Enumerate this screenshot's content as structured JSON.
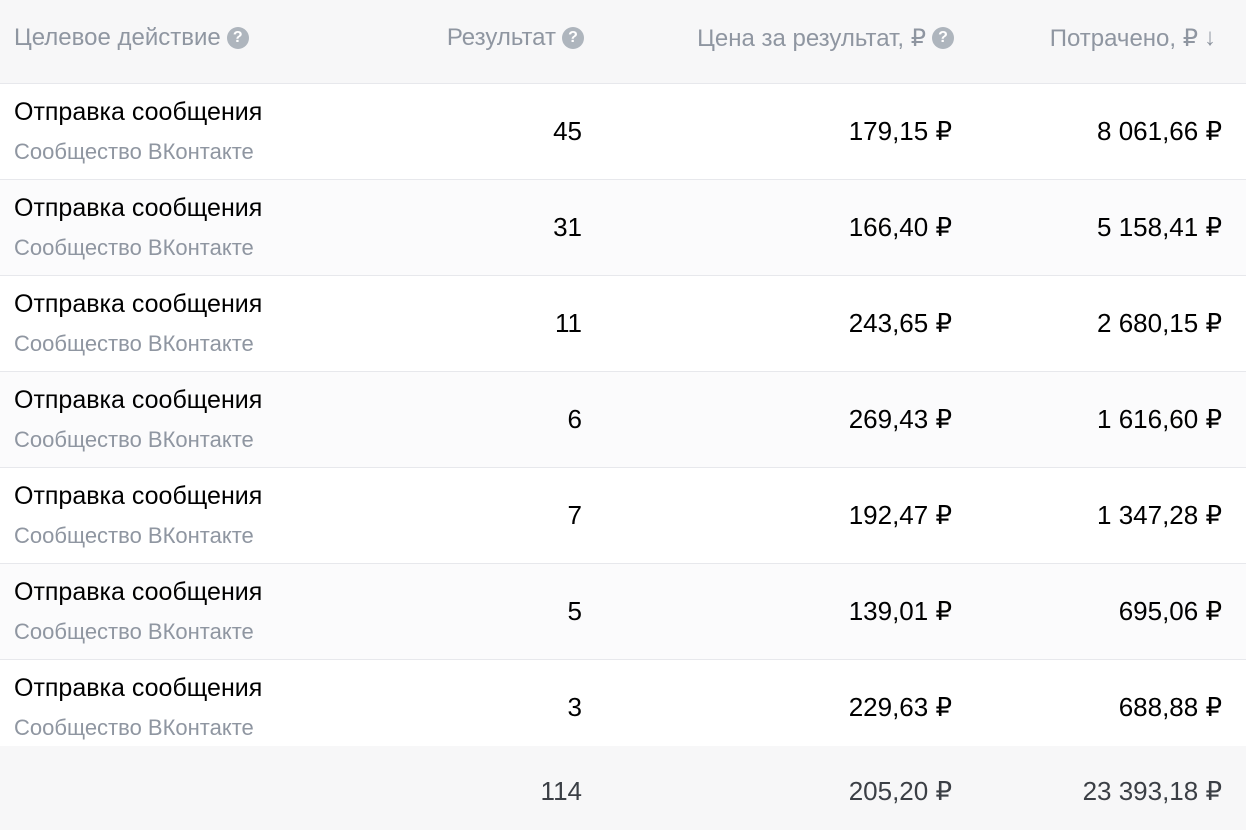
{
  "header": {
    "target_action": "Целевое действие",
    "result": "Результат",
    "price_per_result": "Цена за результат, ₽",
    "spent": "Потрачено, ₽",
    "help_glyph": "?",
    "sort_glyph": "↓"
  },
  "rows": [
    {
      "name": "Отправка сообщения",
      "source": "Сообщество ВКонтакте",
      "result": "45",
      "price": "179,15 ₽",
      "spent": "8 061,66 ₽"
    },
    {
      "name": "Отправка сообщения",
      "source": "Сообщество ВКонтакте",
      "result": "31",
      "price": "166,40 ₽",
      "spent": "5 158,41 ₽"
    },
    {
      "name": "Отправка сообщения",
      "source": "Сообщество ВКонтакте",
      "result": "11",
      "price": "243,65 ₽",
      "spent": "2 680,15 ₽"
    },
    {
      "name": "Отправка сообщения",
      "source": "Сообщество ВКонтакте",
      "result": "6",
      "price": "269,43 ₽",
      "spent": "1 616,60 ₽"
    },
    {
      "name": "Отправка сообщения",
      "source": "Сообщество ВКонтакте",
      "result": "7",
      "price": "192,47 ₽",
      "spent": "1 347,28 ₽"
    },
    {
      "name": "Отправка сообщения",
      "source": "Сообщество ВКонтакте",
      "result": "5",
      "price": "139,01 ₽",
      "spent": "695,06 ₽"
    },
    {
      "name": "Отправка сообщения",
      "source": "Сообщество ВКонтакте",
      "result": "3",
      "price": "229,63 ₽",
      "spent": "688,88 ₽"
    }
  ],
  "totals": {
    "result": "114",
    "price": "205,20 ₽",
    "spent": "23 393,18 ₽"
  }
}
